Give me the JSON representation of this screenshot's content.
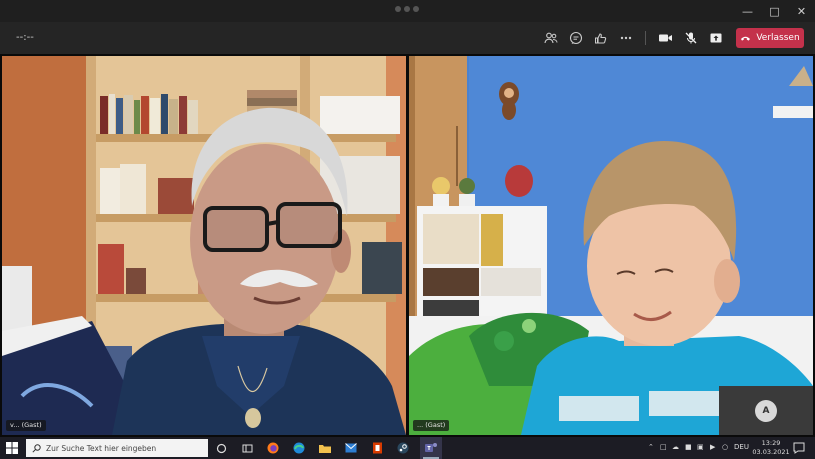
{
  "toolbar": {
    "timer": "--:--",
    "leave_label": "Verlassen",
    "leave_color": "#c4314b"
  },
  "participants": [
    {
      "name": "v... (Gast)"
    },
    {
      "name": "... (Gast)"
    }
  ],
  "self_view": {
    "initial": "A"
  },
  "taskbar": {
    "search_placeholder": "Zur Suche Text hier eingeben",
    "language": "DEU",
    "time": "13:29",
    "date": "03.03.2021"
  }
}
